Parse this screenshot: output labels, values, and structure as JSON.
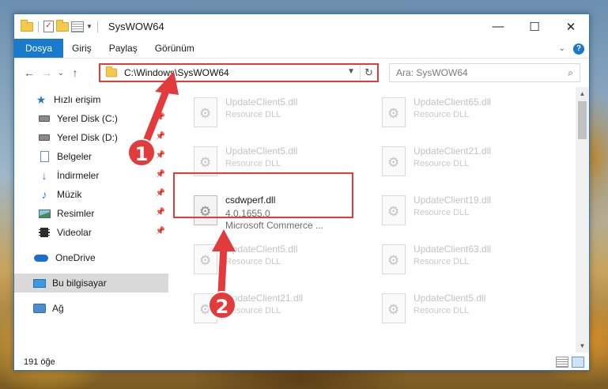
{
  "window": {
    "title": "SysWOW64",
    "controls": {
      "minimize": "—",
      "maximize": "☐",
      "close": "✕"
    }
  },
  "ribbon": {
    "tabs": [
      "Dosya",
      "Giriş",
      "Paylaş",
      "Görünüm"
    ],
    "help": "?"
  },
  "nav": {
    "back": "←",
    "forward": "→",
    "recent": "⌄",
    "up": "↑",
    "address": "C:\\Windows\\SysWOW64",
    "refresh": "↻",
    "search_placeholder": "Ara: SysWOW64",
    "search_icon": "⌕"
  },
  "sidebar": {
    "items": [
      {
        "label": "Hızlı erişim",
        "icon": "star-icon"
      },
      {
        "label": "Yerel Disk (C:)",
        "icon": "drive-icon",
        "pinned": true
      },
      {
        "label": "Yerel Disk (D:)",
        "icon": "drive-icon",
        "pinned": true
      },
      {
        "label": "Belgeler",
        "icon": "documents-icon",
        "pinned": true
      },
      {
        "label": "İndirmeler",
        "icon": "downloads-icon",
        "pinned": true
      },
      {
        "label": "Müzik",
        "icon": "music-icon",
        "pinned": true
      },
      {
        "label": "Resimler",
        "icon": "pictures-icon",
        "pinned": true
      },
      {
        "label": "Videolar",
        "icon": "videos-icon",
        "pinned": true
      },
      {
        "label": "OneDrive",
        "icon": "onedrive-icon"
      },
      {
        "label": "Bu bilgisayar",
        "icon": "this-pc-icon",
        "selected": true
      },
      {
        "label": "Ağ",
        "icon": "network-icon"
      }
    ]
  },
  "files": [
    {
      "name": "UpdateClient5.dll",
      "desc": "Resource DLL"
    },
    {
      "name": "UpdateClient65.dll",
      "desc": "Resource DLL"
    },
    {
      "name": "UpdateClient5.dll",
      "desc": "Resource DLL"
    },
    {
      "name": "UpdateClient21.dll",
      "desc": "Resource DLL"
    },
    {
      "name": "csdwperf.dll",
      "desc": "4.0.1655.0",
      "desc2": "Microsoft Commerce ...",
      "active": true
    },
    {
      "name": "UpdateClient19.dll",
      "desc": "Resource DLL"
    },
    {
      "name": "UpdateClient5.dll",
      "desc": "Resource DLL"
    },
    {
      "name": "UpdateClient63.dll",
      "desc": "Resource DLL"
    },
    {
      "name": "UpdateClient21.dll",
      "desc": "Resource DLL"
    },
    {
      "name": "UpdateClient5.dll",
      "desc": "Resource DLL"
    }
  ],
  "status": {
    "count": "191 öğe"
  },
  "annotations": {
    "badge1": "1",
    "badge2": "2"
  },
  "colors": {
    "accent": "#1979ca",
    "highlight": "#e23b3b"
  }
}
